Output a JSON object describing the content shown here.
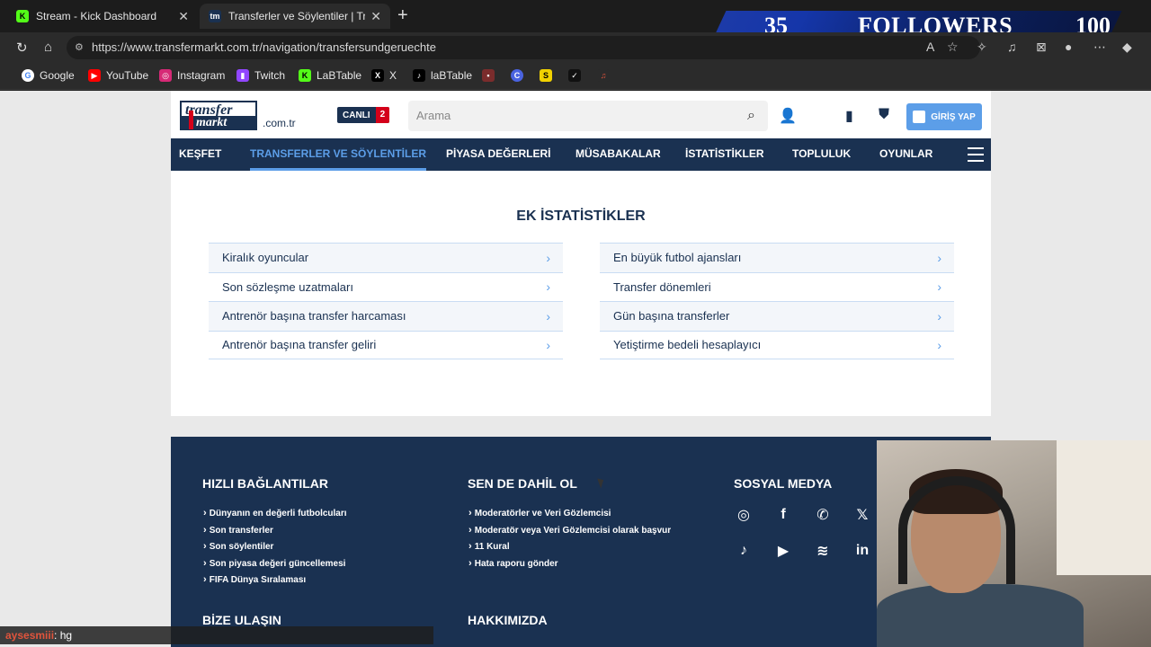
{
  "browser": {
    "tabs": [
      {
        "title": "Stream - Kick Dashboard",
        "icon": "kick-icon"
      },
      {
        "title": "Transferler ve Söylentiler | Transfer",
        "icon": "transfermarkt-icon"
      }
    ],
    "url": "https://www.transfermarkt.com.tr/navigation/transfersundgeruechte",
    "bookmarks": [
      "Google",
      "YouTube",
      "Instagram",
      "Twitch",
      "LaBTable",
      "X",
      "laBTable"
    ]
  },
  "overlay": {
    "followers_current": "35",
    "followers_label": "FOLLOWERS",
    "followers_goal": "100"
  },
  "site": {
    "logo_top": "transfer",
    "logo_bottom": "markt",
    "domain": ".com.tr",
    "live_label": "CANLI",
    "live_count": "2",
    "search_placeholder": "Arama",
    "login_label": "GİRİŞ YAP",
    "nav": [
      "KEŞFET",
      "TRANSFERLER VE SÖYLENTİLER",
      "PİYASA DEĞERLERİ",
      "MÜSABAKALAR",
      "İSTATİSTİKLER",
      "TOPLULUK",
      "OYUNLAR"
    ],
    "section_title": "EK İSTATİSTİKLER",
    "links_left": [
      "Kiralık oyuncular",
      "Son sözleşme uzatmaları",
      "Antrenör başına transfer harcaması",
      "Antrenör başına transfer geliri"
    ],
    "links_right": [
      "En büyük futbol ajansları",
      "Transfer dönemleri",
      "Gün başına transferler",
      "Yetiştirme bedeli hesaplayıcı"
    ]
  },
  "footer": {
    "quick_title": "HIZLI BAĞLANTILAR",
    "quick_links": [
      "Dünyanın en değerli futbolcuları",
      "Son transferler",
      "Son söylentiler",
      "Son piyasa değeri güncellemesi",
      "FIFA Dünya Sıralaması"
    ],
    "join_title": "SEN DE DAHİL OL",
    "join_links": [
      "Moderatörler ve Veri Gözlemcisi",
      "Moderatör veya Veri Gözlemcisi olarak başvur",
      "11 Kural",
      "Hata raporu gönder"
    ],
    "social_title": "SOSYAL MEDYA",
    "contact_title": "BİZE ULAŞIN",
    "about_title": "HAKKIMIZDA"
  },
  "chat": {
    "user": "aysesmiii",
    "message": ": hg"
  }
}
